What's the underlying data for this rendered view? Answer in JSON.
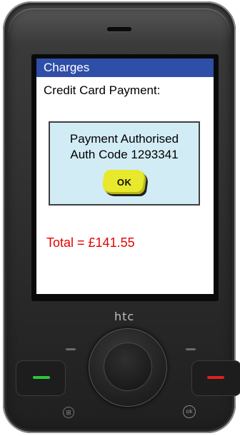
{
  "device": {
    "brand_logo": "htc"
  },
  "screen": {
    "title": "Charges",
    "heading": "Credit Card Payment:",
    "dialog": {
      "line1": "Payment Authorised",
      "line2": "Auth Code 1293341",
      "ok_label": "OK"
    },
    "total": "Total = £141.55"
  },
  "hardware_buttons": {
    "windows_icon": "⊞",
    "ok_icon": "ok"
  },
  "colors": {
    "title_bar": "#2f4ea8",
    "dialog_bg": "#d2ecf5",
    "ok_button": "#e8e82c",
    "total_text": "#e60000",
    "call_green": "#2ec43b",
    "end_red": "#e02020"
  }
}
